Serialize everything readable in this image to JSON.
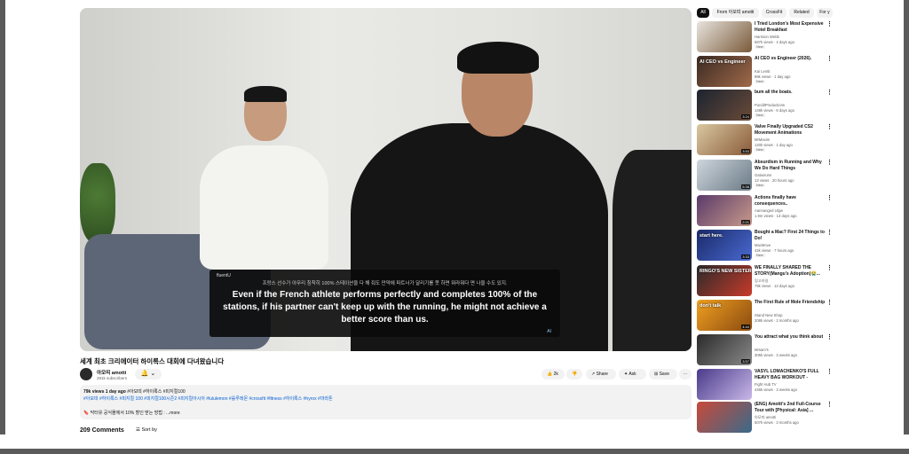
{
  "video": {
    "caption_brand": "fluentU",
    "caption_ko": "프랑스 선수가 아무리 침착히 100% 스테이션을 다 해 줘도 만약에 파트너가 달리기를 못 하면 뭐라뭐다 면 나을 수도 있지.",
    "caption_en": "Even if the French athlete performs perfectly and completes 100% of the stations, if his partner can't keep up with the running, he might not achieve a better score than us.",
    "caption_ai": "AI",
    "title": "세계 최초 크리에이터 하이록스 대회에 다녀왔습니다"
  },
  "channel": {
    "name": "아모띠 amotti",
    "subs": "291k subscribers",
    "bell": "🔔 ⌄"
  },
  "actions": {
    "like": "👍 2k",
    "dislike": "👎",
    "share": "Share",
    "ask": "Ask",
    "save": "Save",
    "more": "···"
  },
  "description": {
    "stats": "79k views 1 day ago",
    "stats_tags": " #아모띠 #하이록스 #피지컬100",
    "hashtags": "#아모띠 #하이록스 #피지컬 100 #피지컬100시즌2 #피지컬아시아 #lululemon #룰루레몬 #crossfit #fitness #하이록스 #hyrox #마라톤",
    "promo": "🔖 닥터유 공식몰에서 10% 할인 받는 방법 : ...more"
  },
  "comments": {
    "count": "209 Comments",
    "sort": "☰ Sort by"
  },
  "chips": [
    "All",
    "From 아모띠 amotti",
    "CrossFit",
    "Related",
    "For y"
  ],
  "recs": [
    {
      "title": "I Tried London's Most Expensive Hotel Breakfast",
      "channel": "Harrison Webb",
      "meta": "587k views · 4 days ago",
      "badge": "New",
      "duration": "",
      "overlay": "",
      "colors": [
        "#e8e4de",
        "#7a5a3a"
      ]
    },
    {
      "title": "AI CEO vs Engineer (2026).",
      "channel": "Kai Lentit",
      "meta": "98k views · 1 day ago",
      "badge": "New",
      "duration": "",
      "overlay": "AI CEO  vs Engineer",
      "colors": [
        "#3a2a22",
        "#a06a4a"
      ]
    },
    {
      "title": "bum all the boats.",
      "channel": "PunditProductions",
      "meta": "148k views · 6 days ago",
      "badge": "New",
      "duration": "3:24",
      "overlay": "",
      "colors": [
        "#1c2430",
        "#6a4a38"
      ]
    },
    {
      "title": "Valve Finally Upgraded CS2 Movement Animations",
      "channel": "MrMaxim",
      "meta": "120k views · 1 day ago",
      "badge": "New",
      "duration": "3:53",
      "overlay": "",
      "colors": [
        "#d8c8a0",
        "#8a5a3a"
      ]
    },
    {
      "title": "Absurdism in Running and Why We Do Hard Things",
      "channel": "Galaxrunn",
      "meta": "13 views · 20 hours ago",
      "badge": "New",
      "duration": "5:38",
      "overlay": "",
      "colors": [
        "#cfd6dc",
        "#6a7a86"
      ]
    },
    {
      "title": "Actions finally have consequences..",
      "channel": "Aannanged Ulgw",
      "meta": "1.9m views · 13 days ago",
      "badge": "",
      "duration": "2:21",
      "overlay": "",
      "colors": [
        "#5a3a6a",
        "#c89a8a"
      ]
    },
    {
      "title": "Bought a Mac? First 24 Things to Do!",
      "channel": "MacMove",
      "meta": "42k views · 7 hours ago",
      "badge": "New",
      "duration": "3:33",
      "overlay": "start here.",
      "colors": [
        "#1a2a6a",
        "#4a6ad0"
      ]
    },
    {
      "title": "WE FINALLY SHARED THE STORY(Mangu's Adoption)😭...",
      "channel": "링고라일",
      "meta": "79k views · 13 days ago",
      "badge": "",
      "duration": "",
      "overlay": "RINGO'S NEW SISTER",
      "colors": [
        "#2a2a2a",
        "#c83a2a"
      ]
    },
    {
      "title": "The First Rule of Mole Friendship",
      "channel": "Stand New Shop",
      "meta": "208k views · 2 months ago",
      "badge": "",
      "duration": "4:44",
      "overlay": "don't talk",
      "colors": [
        "#f0a020",
        "#8a4a10"
      ]
    },
    {
      "title": "You attract what you think about",
      "channel": "Mrsam's",
      "meta": "305k views · 3 weeks ago",
      "badge": "",
      "duration": "3:57",
      "overlay": "",
      "colors": [
        "#2a2a2a",
        "#8a8a8a"
      ]
    },
    {
      "title": "VASYL LOMACHENKO'S FULL HEAVY BAG WORKOUT -",
      "channel": "Fight Hub TV",
      "meta": "446k views · 3 weeks ago",
      "badge": "",
      "duration": "",
      "overlay": "",
      "colors": [
        "#4a3a8a",
        "#c8b8e8"
      ]
    },
    {
      "title": "(ENG) Amotti's 2nd Full-Course Tour with [Physical: Asia] ...",
      "channel": "아모띠 amotti",
      "meta": "507k views · 3 months ago",
      "badge": "",
      "duration": "",
      "overlay": "",
      "colors": [
        "#c84a3a",
        "#3a6a8a"
      ]
    }
  ],
  "rec_dots": "⋮"
}
